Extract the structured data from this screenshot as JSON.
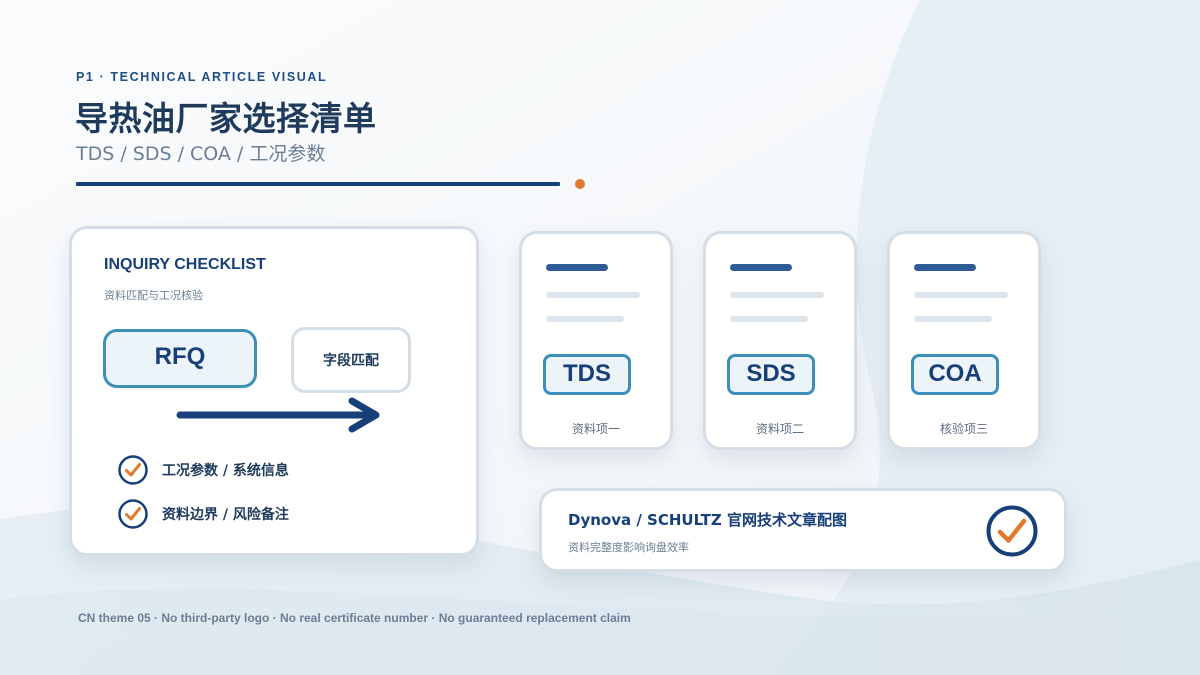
{
  "theme": {
    "accent_navy": "#173f7a",
    "accent_blue": "#3b8fb9",
    "accent_orange": "#e2792c",
    "text_muted": "#6b7f94"
  },
  "header": {
    "eyebrow": "P1 · TECHNICAL ARTICLE VISUAL",
    "title": "导热油厂家选择清单",
    "subtitle": "TDS / SDS / COA / 工况参数"
  },
  "checklist_card": {
    "title": "INQUIRY CHECKLIST",
    "subtitle": "资料匹配与工况核验",
    "rfq_label": "RFQ",
    "match_label": "字段匹配",
    "arrow_icon": "arrow-right-icon",
    "items": [
      {
        "label": "工况参数 / 系统信息",
        "icon": "check-circle-icon"
      },
      {
        "label": "资料边界 / 风险备注",
        "icon": "check-circle-icon"
      }
    ]
  },
  "documents": [
    {
      "badge": "TDS",
      "caption": "资料项一"
    },
    {
      "badge": "SDS",
      "caption": "资料项二"
    },
    {
      "badge": "COA",
      "caption": "核验项三"
    }
  ],
  "summary_card": {
    "title": "Dynova / SCHULTZ 官网技术文章配图",
    "subtitle": "资料完整度影响询盘效率",
    "icon": "check-circle-icon"
  },
  "footnote": "CN theme 05 · No third-party logo · No real certificate number · No guaranteed replacement claim"
}
